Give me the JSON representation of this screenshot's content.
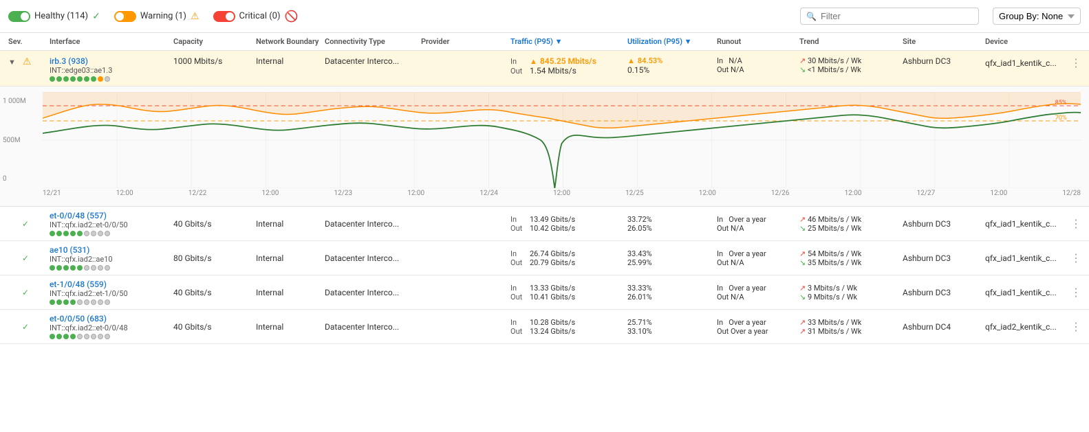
{
  "header": {
    "healthy_label": "Healthy (114)",
    "warning_label": "Warning (1)",
    "critical_label": "Critical (0)",
    "filter_placeholder": "Filter",
    "group_by_label": "Group By: None"
  },
  "table": {
    "columns": {
      "sev": "Sev.",
      "interface": "Interface",
      "capacity": "Capacity",
      "boundary": "Network Boundary",
      "connectivity": "Connectivity Type",
      "provider": "Provider",
      "traffic": "Traffic (P95)",
      "utilization": "Utilization (P95)",
      "runout": "Runout",
      "trend": "Trend",
      "site": "Site",
      "device": "Device"
    }
  },
  "rows": [
    {
      "id": "irb3",
      "severity": "warning",
      "expanded": true,
      "name": "irb.3 (938)",
      "sub": "INT::edge03::ae1.3",
      "capacity": "1000 Mbits/s",
      "boundary": "Internal",
      "connectivity": "Datacenter Interco...",
      "provider": "",
      "traffic_in_label": "In",
      "traffic_in_warn": true,
      "traffic_in": "845.25 Mbits/s",
      "traffic_out_label": "Out",
      "traffic_out": "1.54 Mbits/s",
      "util_in_warn": true,
      "util_in": "84.53%",
      "util_out": "0.15%",
      "runout_in": "N/A",
      "runout_out": "N/A",
      "trend_in": "↗ 30 Mbits/s / Wk",
      "trend_out": "↘ <1 Mbits/s / Wk",
      "site": "Ashburn DC3",
      "device": "qfx_iad1_kentik_c...",
      "dots": [
        "green",
        "green",
        "green",
        "green",
        "green",
        "green",
        "green",
        "orange",
        "gray"
      ]
    },
    {
      "id": "et00",
      "severity": "ok",
      "expanded": false,
      "name": "et-0/0/48 (557)",
      "sub": "INT::qfx.iad2::et-0/0/50",
      "capacity": "40 Gbits/s",
      "boundary": "Internal",
      "connectivity": "Datacenter Interco...",
      "provider": "",
      "traffic_in_label": "In",
      "traffic_in_warn": false,
      "traffic_in": "13.49 Gbits/s",
      "traffic_out_label": "Out",
      "traffic_out": "10.42 Gbits/s",
      "util_in_warn": false,
      "util_in": "33.72%",
      "util_out": "26.05%",
      "runout_in": "Over a year",
      "runout_out": "N/A",
      "trend_in": "↗ 46 Mbits/s / Wk",
      "trend_out": "↘ 25 Mbits/s / Wk",
      "site": "Ashburn DC3",
      "device": "qfx_iad1_kentik_c...",
      "dots": [
        "green",
        "green",
        "green",
        "green",
        "green",
        "gray",
        "gray",
        "gray",
        "gray"
      ]
    },
    {
      "id": "ae10",
      "severity": "ok",
      "expanded": false,
      "name": "ae10 (531)",
      "sub": "INT::qfx.iad2::ae10",
      "capacity": "80 Gbits/s",
      "boundary": "Internal",
      "connectivity": "Datacenter Interco...",
      "provider": "",
      "traffic_in_label": "In",
      "traffic_in_warn": false,
      "traffic_in": "26.74 Gbits/s",
      "traffic_out_label": "Out",
      "traffic_out": "20.79 Gbits/s",
      "util_in_warn": false,
      "util_in": "33.43%",
      "util_out": "25.99%",
      "runout_in": "Over a year",
      "runout_out": "N/A",
      "trend_in": "↗ 54 Mbits/s / Wk",
      "trend_out": "↘ 35 Mbits/s / Wk",
      "site": "Ashburn DC3",
      "device": "qfx_iad1_kentik_c...",
      "dots": [
        "green",
        "green",
        "green",
        "green",
        "green",
        "gray",
        "gray",
        "gray",
        "gray"
      ]
    },
    {
      "id": "et10",
      "severity": "ok",
      "expanded": false,
      "name": "et-1/0/48 (559)",
      "sub": "INT::qfx.iad2::et-1/0/50",
      "capacity": "40 Gbits/s",
      "boundary": "Internal",
      "connectivity": "Datacenter Interco...",
      "provider": "",
      "traffic_in_label": "In",
      "traffic_in_warn": false,
      "traffic_in": "13.33 Gbits/s",
      "traffic_out_label": "Out",
      "traffic_out": "10.41 Gbits/s",
      "util_in_warn": false,
      "util_in": "33.33%",
      "util_out": "26.01%",
      "runout_in": "Over a year",
      "runout_out": "N/A",
      "trend_in": "↗ 3 Mbits/s / Wk",
      "trend_out": "↘ 9 Mbits/s / Wk",
      "site": "Ashburn DC3",
      "device": "qfx_iad1_kentik_c...",
      "dots": [
        "green",
        "green",
        "green",
        "green",
        "gray",
        "gray",
        "gray",
        "gray",
        "gray"
      ]
    },
    {
      "id": "et00b",
      "severity": "ok",
      "expanded": false,
      "name": "et-0/0/50 (683)",
      "sub": "INT::qfx.iad2::et-0/0/48",
      "capacity": "40 Gbits/s",
      "boundary": "Internal",
      "connectivity": "Datacenter Interco...",
      "provider": "",
      "traffic_in_label": "In",
      "traffic_in_warn": false,
      "traffic_in": "10.28 Gbits/s",
      "traffic_out_label": "Out",
      "traffic_out": "13.24 Gbits/s",
      "util_in_warn": false,
      "util_in": "25.71%",
      "util_out": "33.10%",
      "runout_in": "Over a year",
      "runout_out": "Over a year",
      "trend_in": "↗ 33 Mbits/s / Wk",
      "trend_out": "↗ 31 Mbits/s / Wk",
      "site": "Ashburn DC4",
      "device": "qfx_iad2_kentik_c...",
      "dots": [
        "green",
        "green",
        "green",
        "green",
        "gray",
        "gray",
        "gray",
        "gray",
        "gray"
      ]
    }
  ],
  "chart": {
    "y_labels": [
      "1 000M",
      "500M",
      "0"
    ],
    "x_labels": [
      "12/21",
      "12:00",
      "12/22",
      "12:00",
      "12/23",
      "12:00",
      "12/24",
      "12:00",
      "12/25",
      "12:00",
      "12/26",
      "12:00",
      "12/27",
      "12:00",
      "12/28"
    ],
    "threshold_85": "85%",
    "threshold_70": "70%"
  }
}
